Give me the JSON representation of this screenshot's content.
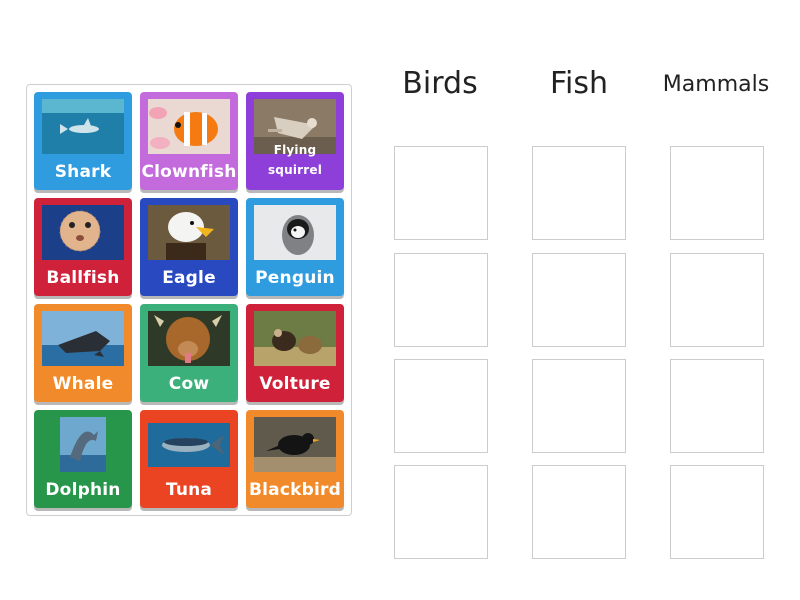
{
  "headers": [
    "Birds",
    "Fish",
    "Mammals"
  ],
  "cards": [
    {
      "label": "Shark",
      "color": "#2f9cdf",
      "icon": "shark-photo"
    },
    {
      "label": "Clownfish",
      "color": "#c36adc",
      "icon": "clownfish-photo"
    },
    {
      "label": "Flying squirrel",
      "color": "#8f3fd9",
      "icon": "flying-squirrel-photo"
    },
    {
      "label": "Ballfish",
      "color": "#d0213b",
      "icon": "ballfish-photo"
    },
    {
      "label": "Eagle",
      "color": "#2949c0",
      "icon": "eagle-photo"
    },
    {
      "label": "Penguin",
      "color": "#2f9cdf",
      "icon": "penguin-photo"
    },
    {
      "label": "Whale",
      "color": "#f08a2a",
      "icon": "whale-photo"
    },
    {
      "label": "Cow",
      "color": "#3cb07b",
      "icon": "cow-photo"
    },
    {
      "label": "Volture",
      "color": "#d0213b",
      "icon": "vulture-photo"
    },
    {
      "label": "Dolphin",
      "color": "#27954a",
      "icon": "dolphin-photo"
    },
    {
      "label": "Tuna",
      "color": "#ea4423",
      "icon": "tuna-photo"
    },
    {
      "label": "Blackbird",
      "color": "#f08a2a",
      "icon": "blackbird-photo"
    }
  ]
}
